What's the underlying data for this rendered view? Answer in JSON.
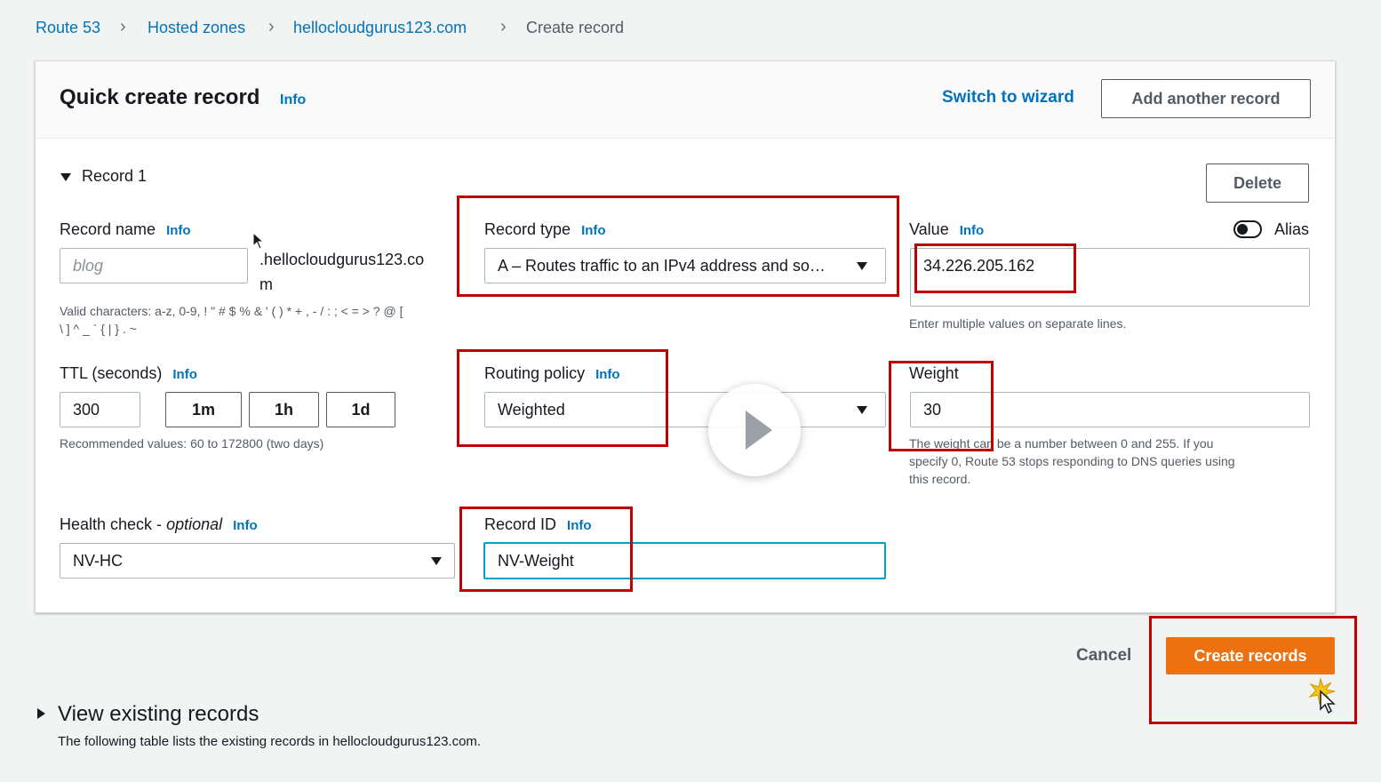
{
  "breadcrumb": {
    "items": [
      "Route 53",
      "Hosted zones",
      "hellocloudgurus123.com",
      "Create record"
    ]
  },
  "header": {
    "title": "Quick create record",
    "info": "Info",
    "switch_wizard": "Switch to wizard",
    "add_another": "Add another record"
  },
  "record": {
    "section_label": "Record 1",
    "delete_label": "Delete",
    "name": {
      "label": "Record name",
      "info": "Info",
      "placeholder": "blog",
      "suffix_line1": ".hellocloudgurus123.co",
      "suffix_line2": "m",
      "hint_line1": "Valid characters: a-z, 0-9, ! \" # $ % & ' ( ) * + , - / : ; < = > ? @ [",
      "hint_line2": "\\ ] ^ _ ` { | } . ~"
    },
    "type": {
      "label": "Record type",
      "info": "Info",
      "value": "A – Routes traffic to an IPv4 address and so…"
    },
    "value": {
      "label": "Value",
      "info": "Info",
      "alias_label": "Alias",
      "text": "34.226.205.162",
      "hint": "Enter multiple values on separate lines."
    },
    "ttl": {
      "label": "TTL (seconds)",
      "info": "Info",
      "value": "300",
      "presets": [
        "1m",
        "1h",
        "1d"
      ],
      "hint": "Recommended values: 60 to 172800 (two days)"
    },
    "routing": {
      "label": "Routing policy",
      "info": "Info",
      "value": "Weighted"
    },
    "weight": {
      "label": "Weight",
      "value": "30",
      "hint_line1": "The weight can be a number between 0 and 255. If you",
      "hint_line2": "specify 0, Route 53 stops responding to DNS queries using",
      "hint_line3": "this record."
    },
    "health": {
      "label": "Health check - ",
      "label_italic": "optional",
      "info": "Info",
      "value": "NV-HC"
    },
    "record_id": {
      "label": "Record ID",
      "info": "Info",
      "value": "NV-Weight"
    }
  },
  "footer": {
    "cancel": "Cancel",
    "create": "Create records"
  },
  "existing": {
    "title": "View existing records",
    "description": "The following table lists the existing records in hellocloudgurus123.com."
  },
  "colors": {
    "link": "#0073bb",
    "primary_button": "#ec7211",
    "highlight": "#c00000"
  },
  "icons": [
    "caret-down-icon",
    "chevron-right-icon",
    "toggle-icon",
    "play-icon",
    "cursor-icon"
  ]
}
